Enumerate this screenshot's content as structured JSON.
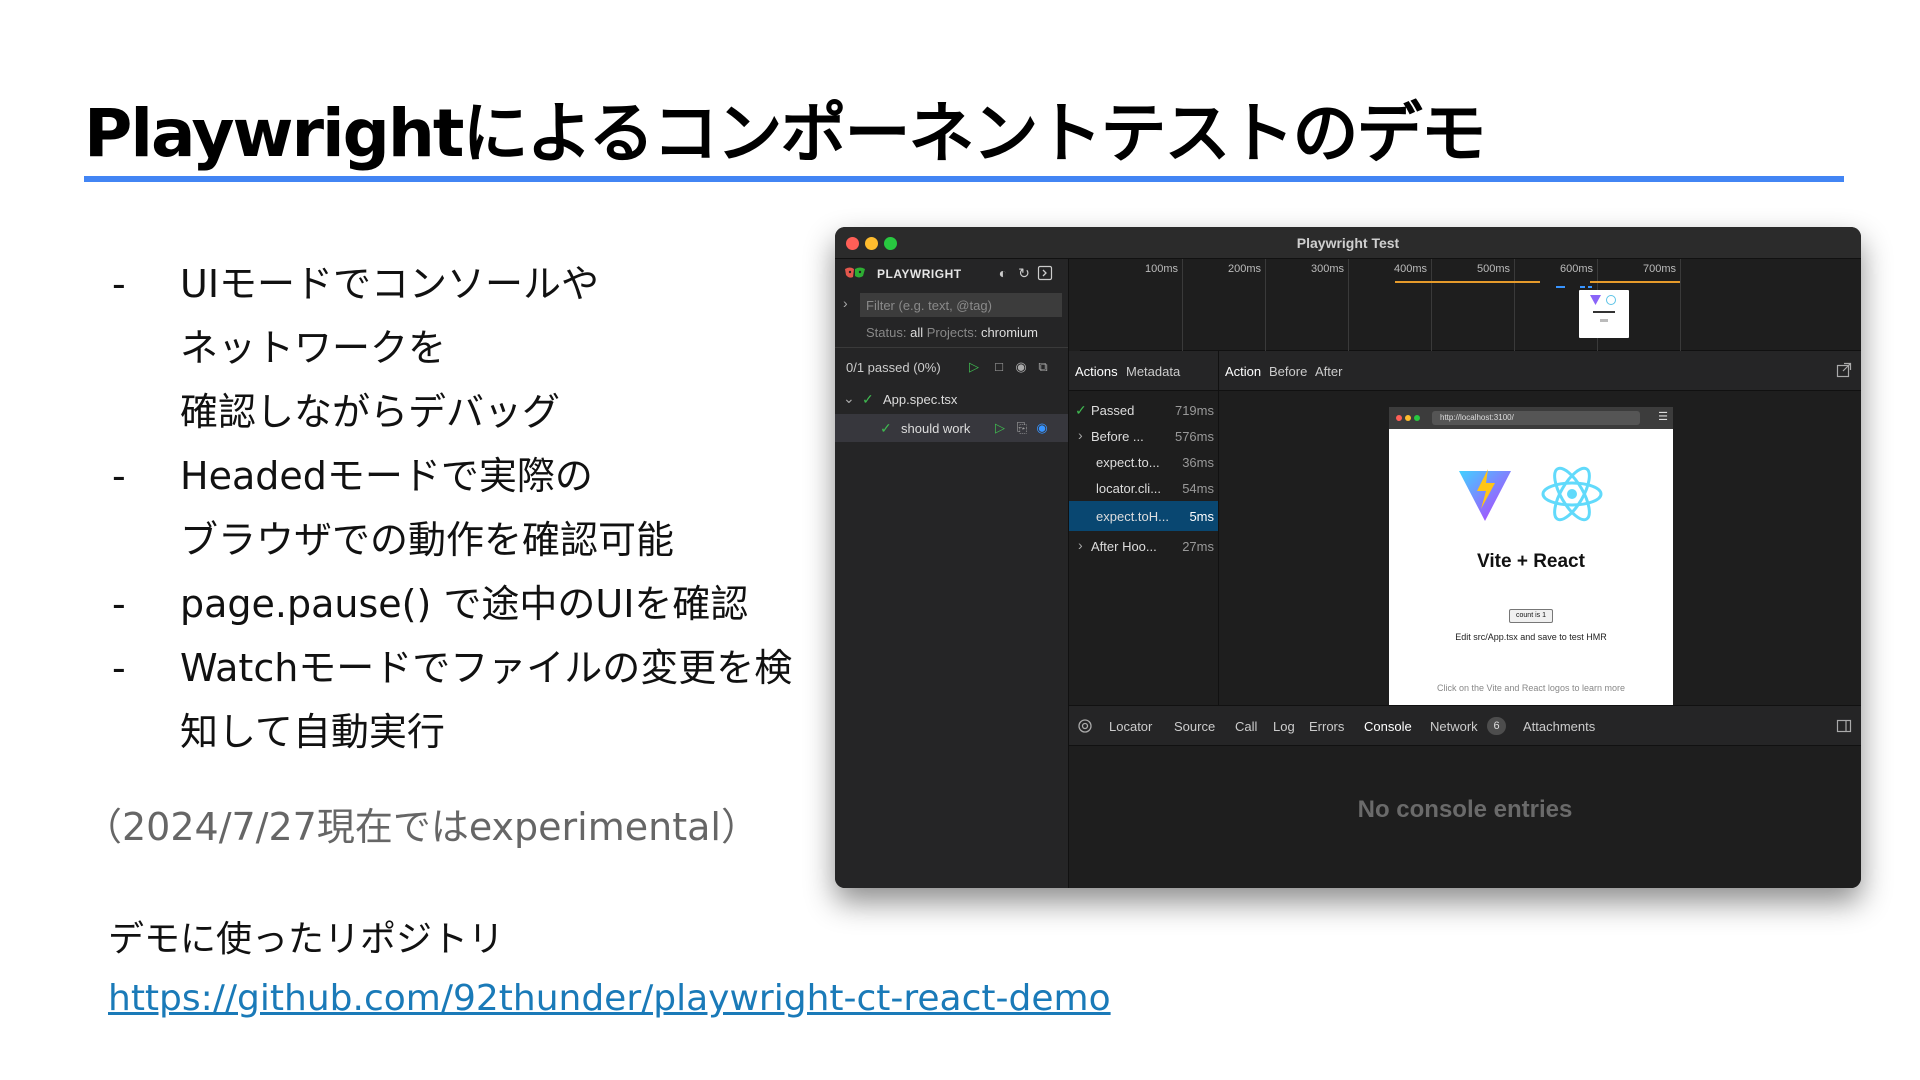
{
  "slide": {
    "title": "Playwrightによるコンポーネントテストのデモ",
    "bullets": [
      {
        "dash": "-",
        "lines": [
          "UIモードでコンソールや",
          "ネットワークを",
          "確認しながらデバッグ"
        ]
      },
      {
        "dash": "-",
        "lines": [
          "Headedモードで実際の",
          "ブラウザでの動作を確認可能"
        ]
      },
      {
        "dash": "-",
        "lines": [
          "page.pause() で途中のUIを確認"
        ]
      },
      {
        "dash": "-",
        "lines": [
          "Watchモードでファイルの変更を検",
          "知して自動実行"
        ]
      }
    ],
    "note": "（2024/7/27現在ではexperimental）",
    "repo_label": "デモに使ったリポジトリ",
    "repo_link": "https://github.com/92thunder/playwright-ct-react-demo",
    "accent_color": "#4285f4"
  },
  "window": {
    "title": "Playwright Test",
    "sidebar": {
      "brand": "PLAYWRIGHT",
      "filter_placeholder": "Filter (e.g. text, @tag)",
      "status_label": "Status:",
      "status_value": "all",
      "projects_label": "Projects:",
      "projects_value": "chromium",
      "counts": "0/1 passed (0%)",
      "file": "App.spec.tsx",
      "test": "should work"
    },
    "timeline": {
      "ticks": [
        "100ms",
        "200ms",
        "300ms",
        "400ms",
        "500ms",
        "600ms",
        "700ms"
      ]
    },
    "actions": {
      "tabs": [
        "Actions",
        "Metadata"
      ],
      "rows": [
        {
          "label": "Passed",
          "time": "719ms"
        },
        {
          "label": "Before ...",
          "time": "576ms"
        },
        {
          "label": "expect.to...",
          "time": "36ms"
        },
        {
          "label": "locator.cli...",
          "time": "54ms"
        },
        {
          "label": "expect.toH...",
          "time": "5ms"
        },
        {
          "label": "After Hoo...",
          "time": "27ms"
        }
      ]
    },
    "detail_tabs": [
      "Action",
      "Before",
      "After"
    ],
    "preview": {
      "url": "http://localhost:3100/",
      "heading": "Vite + React",
      "count_button": "count is 1",
      "edit_text": "Edit src/App.tsx and save to test HMR",
      "footer": "Click on the Vite and React logos to learn more"
    },
    "bottom_tabs": [
      "Locator",
      "Source",
      "Call",
      "Log",
      "Errors",
      "Console",
      "Network",
      "Attachments"
    ],
    "network_count": "6",
    "console_empty": "No console entries"
  }
}
